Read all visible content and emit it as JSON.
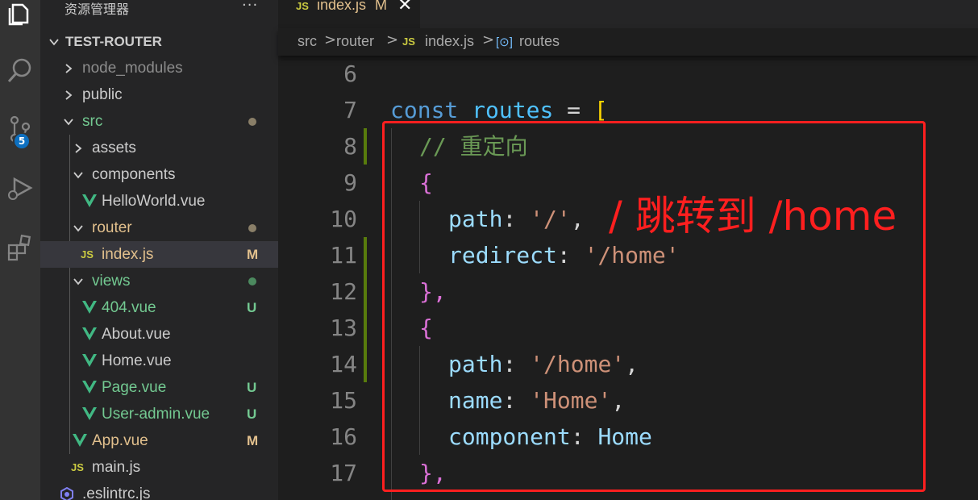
{
  "sidebar": {
    "header": "资源管理器",
    "more": "···",
    "project": "TEST-ROUTER",
    "items": [
      {
        "label": "node_modules",
        "status": ""
      },
      {
        "label": "public",
        "status": ""
      },
      {
        "label": "src",
        "status": ""
      },
      {
        "label": "assets",
        "status": ""
      },
      {
        "label": "components",
        "status": ""
      },
      {
        "label": "HelloWorld.vue",
        "status": ""
      },
      {
        "label": "router",
        "status": ""
      },
      {
        "label": "index.js",
        "status": "M"
      },
      {
        "label": "views",
        "status": ""
      },
      {
        "label": "404.vue",
        "status": "U"
      },
      {
        "label": "About.vue",
        "status": ""
      },
      {
        "label": "Home.vue",
        "status": ""
      },
      {
        "label": "Page.vue",
        "status": "U"
      },
      {
        "label": "User-admin.vue",
        "status": "U"
      },
      {
        "label": "App.vue",
        "status": "M"
      },
      {
        "label": "main.js",
        "status": ""
      },
      {
        "label": ".eslintrc.js",
        "status": ""
      }
    ],
    "source_control_badge": "5"
  },
  "tab": {
    "icon": "JS",
    "label": "index.js",
    "status": "M",
    "close": "✕"
  },
  "breadcrumb": {
    "items": [
      "src",
      "router",
      "index.js",
      "routes"
    ],
    "separator": ">",
    "js_icon": "JS",
    "symbol_icon": "[⊙]"
  },
  "code": {
    "line_numbers": [
      "6",
      "7",
      "8",
      "9",
      "10",
      "11",
      "12",
      "13",
      "14",
      "15",
      "16",
      "17"
    ],
    "lines": {
      "l7_const": "const",
      "l7_routes": "routes",
      "l7_eq": " = ",
      "l7_bracket": "[",
      "l8_comment": "// 重定向",
      "l9_brace": "{",
      "l10_key": "path",
      "l10_colon": ": ",
      "l10_val": "'/'",
      "l10_comma": ",",
      "l11_key": "redirect",
      "l11_colon": ": ",
      "l11_val": "'/home'",
      "l12_close": "},",
      "l13_brace": "{",
      "l14_key": "path",
      "l14_colon": ": ",
      "l14_val": "'/home'",
      "l14_comma": ",",
      "l15_key": "name",
      "l15_colon": ": ",
      "l15_val": "'Home'",
      "l15_comma": ",",
      "l16_key": "component",
      "l16_colon": ": ",
      "l16_val": "Home",
      "l17_close": "},"
    }
  },
  "annotation": {
    "text": "/ 跳转到 /home",
    "color": "#ff1f1f"
  },
  "colors": {
    "accent": "#0e70c0",
    "modified": "#e2c08d",
    "untracked": "#73c991",
    "annotation": "#ff1f1f"
  }
}
